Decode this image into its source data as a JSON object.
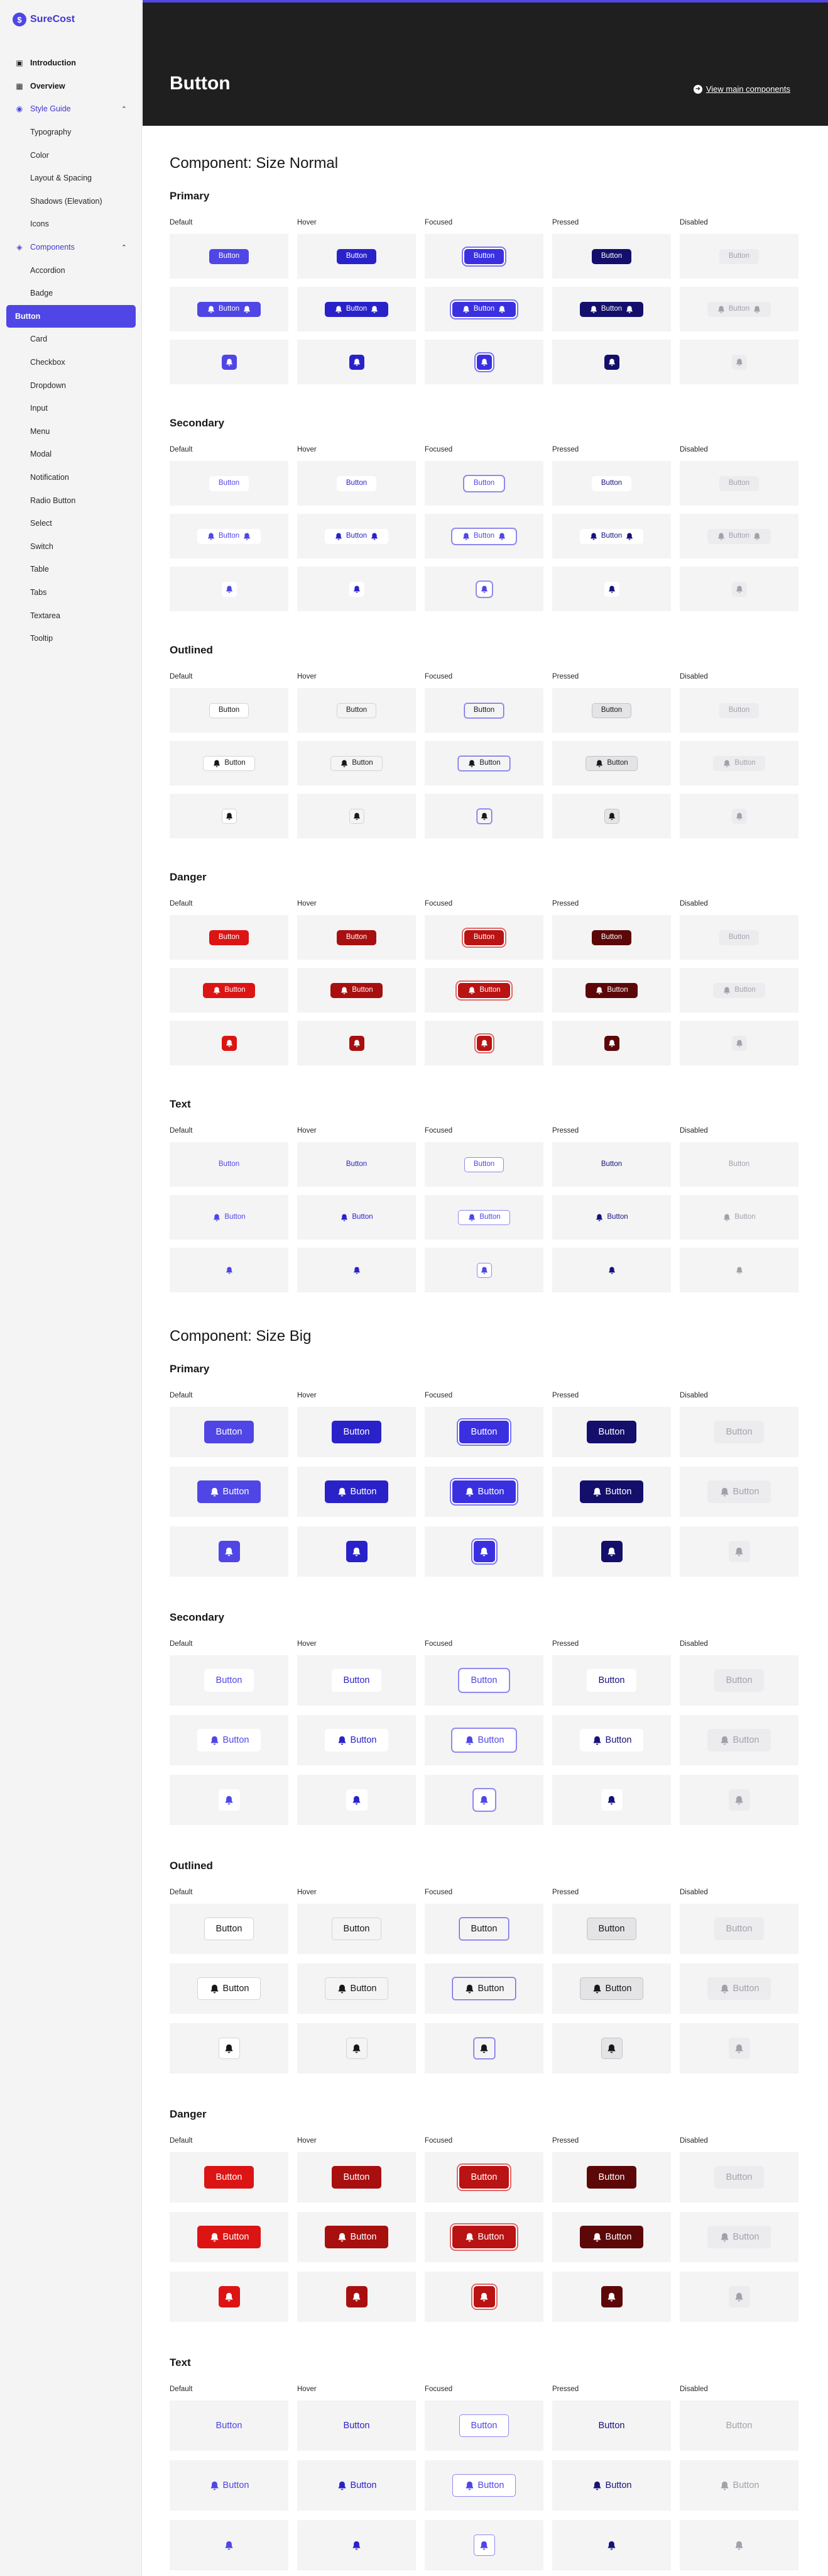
{
  "app": {
    "name": "SureCost"
  },
  "sidebar": {
    "items": [
      {
        "label": "Introduction",
        "icon": "book-icon",
        "kind": "top"
      },
      {
        "label": "Overview",
        "icon": "grid-icon",
        "kind": "top"
      },
      {
        "label": "Style Guide",
        "icon": "palette-icon",
        "kind": "open"
      },
      {
        "label": "Typography",
        "kind": "sub"
      },
      {
        "label": "Color",
        "kind": "sub"
      },
      {
        "label": "Layout & Spacing",
        "kind": "sub"
      },
      {
        "label": "Shadows (Elevation)",
        "kind": "sub"
      },
      {
        "label": "Icons",
        "kind": "sub"
      },
      {
        "label": "Components",
        "icon": "layers-icon",
        "kind": "open"
      },
      {
        "label": "Accordion",
        "kind": "sub"
      },
      {
        "label": "Badge",
        "kind": "sub"
      },
      {
        "label": "Button",
        "kind": "active"
      },
      {
        "label": "Card",
        "kind": "sub"
      },
      {
        "label": "Checkbox",
        "kind": "sub"
      },
      {
        "label": "Dropdown",
        "kind": "sub"
      },
      {
        "label": "Input",
        "kind": "sub"
      },
      {
        "label": "Menu",
        "kind": "sub"
      },
      {
        "label": "Modal",
        "kind": "sub"
      },
      {
        "label": "Notification",
        "kind": "sub"
      },
      {
        "label": "Radio Button",
        "kind": "sub"
      },
      {
        "label": "Select",
        "kind": "sub"
      },
      {
        "label": "Switch",
        "kind": "sub"
      },
      {
        "label": "Table",
        "kind": "sub"
      },
      {
        "label": "Tabs",
        "kind": "sub"
      },
      {
        "label": "Textarea",
        "kind": "sub"
      },
      {
        "label": "Tooltip",
        "kind": "sub"
      }
    ]
  },
  "header": {
    "title": "Button",
    "link_label": "View main components"
  },
  "states": [
    "Default",
    "Hover",
    "Focused",
    "Pressed",
    "Disabled"
  ],
  "button_label": "Button",
  "sections": [
    {
      "title": "Component: Size Normal",
      "size": "normal",
      "groups": [
        {
          "title": "Primary",
          "variant": "primary"
        },
        {
          "title": "Secondary",
          "variant": "secondary"
        },
        {
          "title": "Outlined",
          "variant": "outlined"
        },
        {
          "title": "Danger",
          "variant": "danger"
        },
        {
          "title": "Text",
          "variant": "text"
        }
      ]
    },
    {
      "title": "Component: Size Big",
      "size": "big",
      "groups": [
        {
          "title": "Primary",
          "variant": "primary"
        },
        {
          "title": "Secondary",
          "variant": "secondary"
        },
        {
          "title": "Outlined",
          "variant": "outlined"
        },
        {
          "title": "Danger",
          "variant": "danger"
        },
        {
          "title": "Text",
          "variant": "text"
        }
      ]
    }
  ],
  "colors": {
    "brand": "#4f46e5",
    "sidebar_bg": "#f4f4f5",
    "header_bg": "#1f1f1f",
    "cell_bg": "#f4f4f5",
    "primary": [
      "#4f46e5",
      "#2a22c9",
      "#3a30e0",
      "#130f6b",
      "#ececef"
    ],
    "danger": [
      "#dc1414",
      "#a80f0f",
      "#b91313",
      "#5c0808",
      "#ececef"
    ],
    "link": [
      "#4f46e5",
      "#2a22c9",
      "#4f46e5",
      "#16127a",
      "#a1a1aa"
    ],
    "disabled_text": "#a1a1aa"
  }
}
